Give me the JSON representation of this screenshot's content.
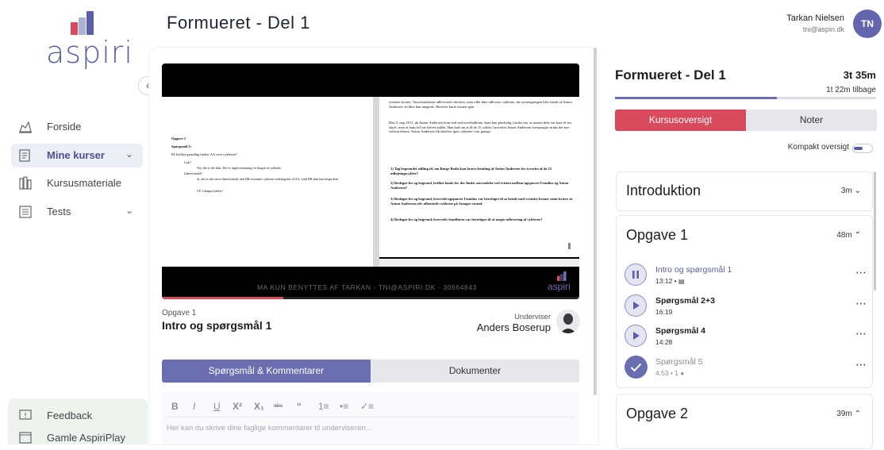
{
  "app": {
    "logo_text": "aspiri",
    "brand_color": "#6366ae",
    "accent_red": "#d94b5c"
  },
  "header": {
    "title": "Formueret - Del 1",
    "user_name": "Tarkan Nielsen",
    "user_email": "tni@aspiri.dk",
    "avatar_initials": "TN"
  },
  "sidebar": {
    "collapse_icon": "chevron-left-icon",
    "items": [
      {
        "label": "Forside",
        "icon": "home-icon",
        "active": false
      },
      {
        "label": "Mine kurser",
        "icon": "courses-icon",
        "active": true,
        "expandable": true
      },
      {
        "label": "Kursusmateriale",
        "icon": "library-icon",
        "active": false
      },
      {
        "label": "Tests",
        "icon": "tests-icon",
        "active": false,
        "expandable": true
      }
    ],
    "bottom_items": [
      {
        "label": "Feedback",
        "icon": "feedback-icon"
      },
      {
        "label": "Gamle AspiriPlay",
        "icon": "window-icon"
      }
    ]
  },
  "video": {
    "watermark": "MA KUN BENYTTES AF TARKAN - TNI@ASPIRI.DK - 30664843",
    "logo_text": "aspiri",
    "progress": 0.29,
    "doc_left": {
      "heading1": "Opgave 1",
      "heading2": "Spørgsmål 1:",
      "question": "På hvilket grundlag hæfter AA over cyklerne?",
      "line1": "Løje?",
      "line2": "Nej, det er det ikke. Der er ingen erstatning for brugen af cyklerne.",
      "line3": "Lånerforhold?",
      "line4": "Ja, der er tale om et lånerforhold, idet BB overlader cyklerne vederlagsfrit til AA, fordi BB ikke kan bruge dem.",
      "line5": "UF: Lånager hæfter!"
    },
    "doc_right": {
      "para1": "svenske kroner. Taxachaufføren udleverede checken, men ville ikke udlevere cyklerne, før taxaregningen blev betalt af Anton Andersen, hvilket han nægtede. Herefter kørte taxaen igen.",
      "para2": "Den 3. maj 2011, da Anton Andersen kom ned ved torvehallerne, kom han pludselig i tanke om, at taxaen ikke var kørt til sin skole, men at hans bil var blevet stjålet. Han bad om at få de 15 cykler, hvorefter Anton Andersen forespurgte straks det nye softwarefirma. Anton Andersen fik derefter igen cyklerne i sin garage.",
      "q1": "1) Tag begrundet stilling til, om Børge Bodst kan kræve betaling af Anton Andersen for tyveriet af de 15 udlejningscykler?",
      "q2": "2) Redegør for og begrund, hvilket lands lov der finder anvendelse ved tvisten mellem ugeparret Umulius og Anton Andersen?",
      "q3": "3) Redegør for og begrund, hvorvidt ugeparret Umulius var berettiget til at betale med svenske kroner samt kræve at Anton Andersen selv afhentede cyklerne på Amager strand.",
      "q4": "4) Redegør for og begrund, hvorvidt chaufføren var berettiget til at nægte udlevering af cyklerne?"
    }
  },
  "lesson": {
    "group": "Opgave 1",
    "title": "Intro og spørgsmål 1",
    "instructor_label": "Underviser",
    "instructor_name": "Anders Boserup"
  },
  "tabs": {
    "qa": "Spørgsmål & Kommentarer",
    "docs": "Dokumenter"
  },
  "editor": {
    "toolbar": [
      "B",
      "I",
      "U",
      "X²",
      "X₁",
      "abc",
      "“",
      "1≡",
      "•≡",
      "✓≡"
    ],
    "placeholder": "Her kan du skrive dine faglige kommentarer til underviseren..."
  },
  "course_panel": {
    "title": "Formueret - Del 1",
    "total_time": "3t 35m",
    "time_left": "1t 22m tilbage",
    "progress": 0.62,
    "tab_overview": "Kursusoversigt",
    "tab_notes": "Noter",
    "compact_label": "Kompakt oversigt",
    "compact_on": true,
    "sections": [
      {
        "title": "Introduktion",
        "duration": "3m",
        "expanded": false
      },
      {
        "title": "Opgave 1",
        "duration": "48m",
        "expanded": true,
        "lessons": [
          {
            "title": "Intro og spørgsmål 1",
            "meta": "13:12 •",
            "state": "playing",
            "has_note": true
          },
          {
            "title": "Spørgsmål 2+3",
            "meta": "16:19",
            "state": "unwatched"
          },
          {
            "title": "Spørgsmål 4",
            "meta": "14:28",
            "state": "unwatched"
          },
          {
            "title": "Spørgsmål 5",
            "meta": "4:53 • 1",
            "state": "done",
            "has_comment": true
          }
        ]
      },
      {
        "title": "Opgave 2",
        "duration": "39m",
        "expanded": true
      }
    ]
  }
}
